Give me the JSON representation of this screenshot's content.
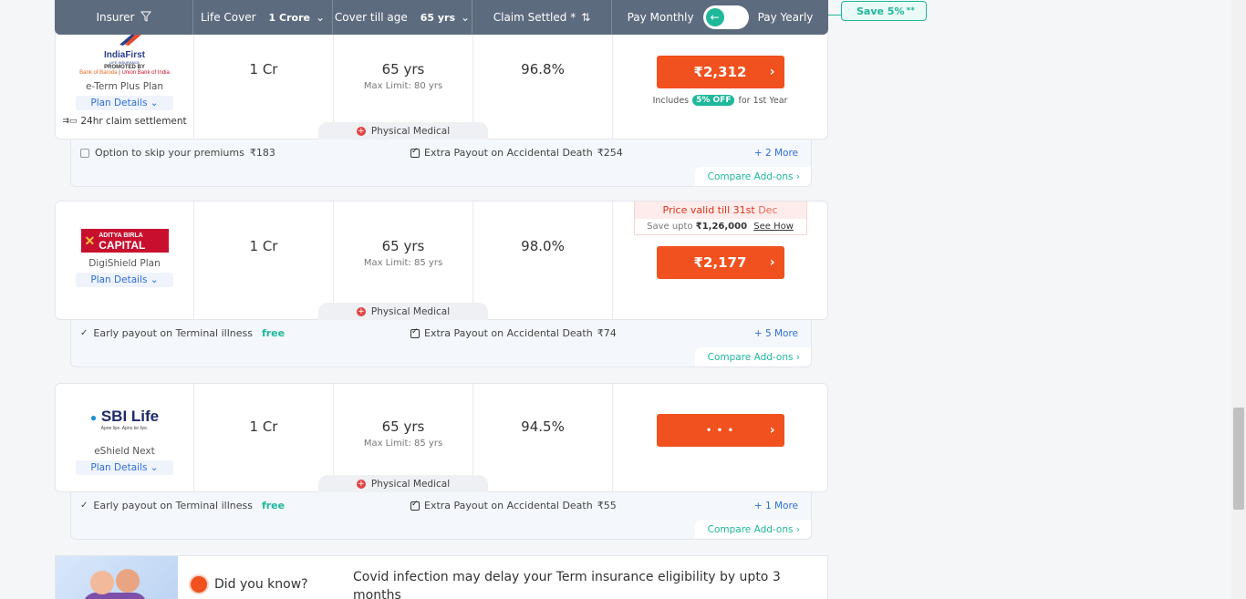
{
  "header": {
    "insurer": "Insurer",
    "life_cover_label": "Life Cover",
    "life_cover_value": "1 Crore",
    "cover_age_label": "Cover till age",
    "cover_age_value": "65 yrs",
    "claim_label": "Claim Settled *",
    "pay_monthly": "Pay Monthly",
    "pay_yearly": "Pay Yearly",
    "save_tag": "Save 5%",
    "save_sup": "**"
  },
  "plans": [
    {
      "logo_name": "IndiaFirst",
      "logo_sub": "LIFE INSURANCE",
      "logo_promoted": "PROMOTED BY",
      "logo_bank1": "Bank of Baroda",
      "logo_bank2": "Union Bank of India",
      "plan_name": "e-Term Plus Plan",
      "plan_details": "Plan Details",
      "claim_note": "24hr claim settlement",
      "cover": "1 Cr",
      "age": "65 yrs",
      "max_limit": "Max Limit: 80 yrs",
      "claim": "96.8%",
      "price": "₹2,312",
      "includes_pre": "Includes",
      "discount": "5% OFF",
      "includes_post": "for 1st Year",
      "medical": "Physical Medical",
      "addon1": "Option to skip your premiums",
      "addon1_price": "₹183",
      "addon2": "Extra Payout on Accidental Death",
      "addon2_price": "₹254",
      "more": "+ 2 More",
      "compare": "Compare Add-ons"
    },
    {
      "logo_top": "ADITYA BIRLA",
      "logo_bottom": "CAPITAL",
      "plan_name": "DigiShield Plan",
      "plan_details": "Plan Details",
      "cover": "1 Cr",
      "age": "65 yrs",
      "max_limit": "Max Limit: 85 yrs",
      "claim": "98.0%",
      "price_valid_pre": "Price valid till",
      "price_valid_date": "31st",
      "price_valid_month": "Dec",
      "save_upto": "Save upto",
      "save_amount": "₹1,26,000",
      "see_how": "See How",
      "price": "₹2,177",
      "medical": "Physical Medical",
      "addon1": "Early payout on Terminal illness",
      "addon1_free": "free",
      "addon2": "Extra Payout on Accidental Death",
      "addon2_price": "₹74",
      "more": "+ 5 More",
      "compare": "Compare Add-ons"
    },
    {
      "logo_name": "SBI Life",
      "logo_tag": "Apne liye. Apno ke liye.",
      "plan_name": "eShield Next",
      "plan_details": "Plan Details",
      "cover": "1 Cr",
      "age": "65 yrs",
      "max_limit": "Max Limit: 85 yrs",
      "claim": "94.5%",
      "loading": "• • •",
      "medical": "Physical Medical",
      "addon1": "Early payout on Terminal illness",
      "addon1_free": "free",
      "addon2": "Extra Payout on Accidental Death",
      "addon2_price": "₹55",
      "more": "+ 1 More",
      "compare": "Compare Add-ons"
    }
  ],
  "promo": {
    "title": "Did you know?",
    "text": "Covid infection may delay your Term insurance eligibility by upto 3 months"
  },
  "colors": {
    "accent": "#f0511e",
    "green": "#1eb89a",
    "header": "#5d6b7e",
    "link": "#2f6fd6"
  }
}
